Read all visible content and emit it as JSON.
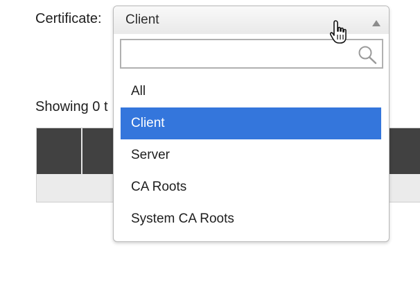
{
  "form": {
    "certificate_label": "Certificate:",
    "showing_text": "Showing 0 t"
  },
  "select": {
    "value": "Client",
    "search_value": "",
    "search_placeholder": "",
    "options": [
      {
        "label": "All",
        "selected": false
      },
      {
        "label": "Client",
        "selected": true
      },
      {
        "label": "Server",
        "selected": false
      },
      {
        "label": "CA Roots",
        "selected": false
      },
      {
        "label": "System CA Roots",
        "selected": false
      }
    ]
  },
  "colors": {
    "highlight": "#3476dc",
    "table_header": "#414141",
    "table_body": "#ebebeb"
  },
  "icons": {
    "search": "search-icon",
    "caret": "caret-up-icon",
    "cursor": "hand-pointer-icon"
  }
}
